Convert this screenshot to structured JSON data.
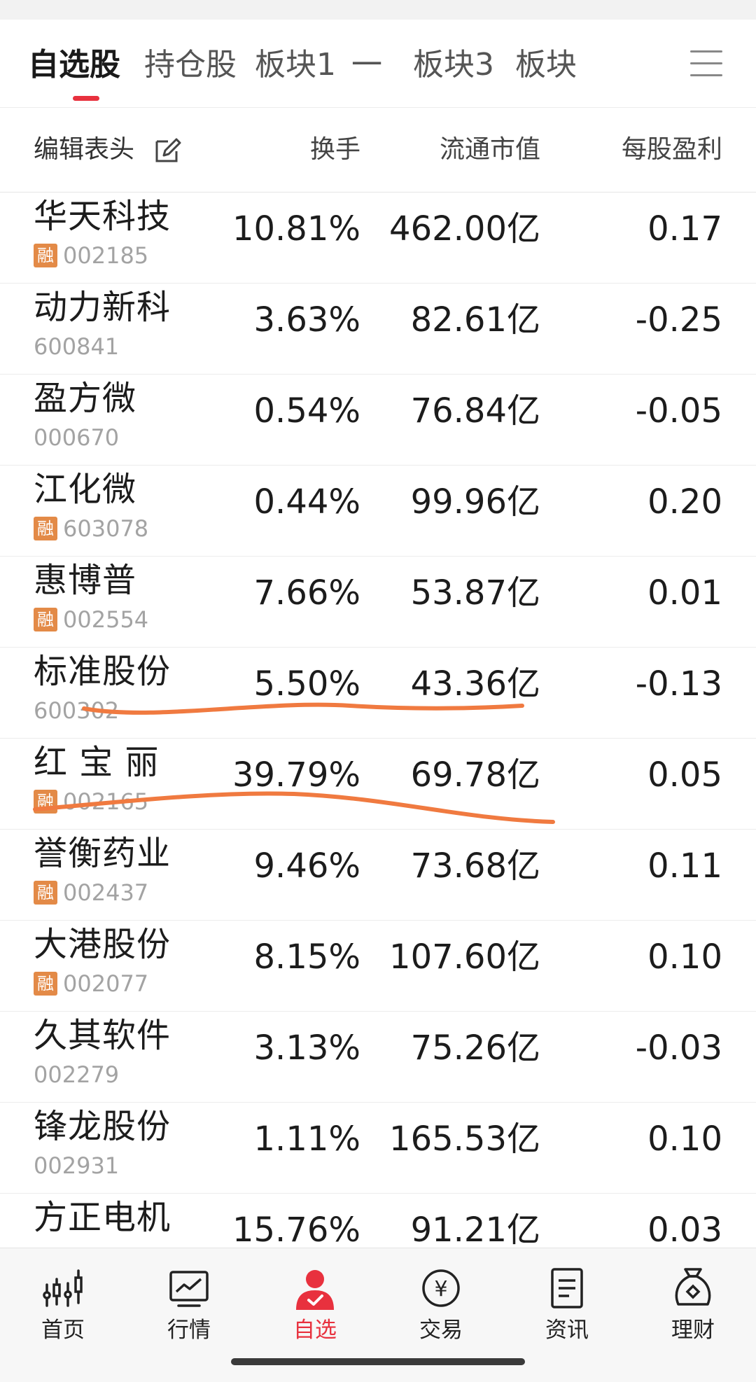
{
  "tabs": [
    {
      "label": "自选股",
      "active": true
    },
    {
      "label": "持仓股",
      "active": false
    },
    {
      "label": "板块1",
      "active": false
    },
    {
      "label": "一",
      "active": false
    },
    {
      "label": "板块3",
      "active": false
    },
    {
      "label": "板块",
      "active": false
    }
  ],
  "header": {
    "edit_label": "编辑表头",
    "col_turnover": "换手",
    "col_market_cap": "流通市值",
    "col_eps": "每股盈利"
  },
  "badge_text": "融",
  "stocks": [
    {
      "name": "华天科技",
      "code": "002185",
      "margin": true,
      "turnover": "10.81%",
      "market_cap": "462.00亿",
      "eps": "0.17"
    },
    {
      "name": "动力新科",
      "code": "600841",
      "margin": false,
      "turnover": "3.63%",
      "market_cap": "82.61亿",
      "eps": "-0.25"
    },
    {
      "name": "盈方微",
      "code": "000670",
      "margin": false,
      "turnover": "0.54%",
      "market_cap": "76.84亿",
      "eps": "-0.05"
    },
    {
      "name": "江化微",
      "code": "603078",
      "margin": true,
      "turnover": "0.44%",
      "market_cap": "99.96亿",
      "eps": "0.20"
    },
    {
      "name": "惠博普",
      "code": "002554",
      "margin": true,
      "turnover": "7.66%",
      "market_cap": "53.87亿",
      "eps": "0.01"
    },
    {
      "name": "标准股份",
      "code": "600302",
      "margin": false,
      "turnover": "5.50%",
      "market_cap": "43.36亿",
      "eps": "-0.13"
    },
    {
      "name": "红 宝 丽",
      "code": "002165",
      "margin": true,
      "turnover": "39.79%",
      "market_cap": "69.78亿",
      "eps": "0.05"
    },
    {
      "name": "誉衡药业",
      "code": "002437",
      "margin": true,
      "turnover": "9.46%",
      "market_cap": "73.68亿",
      "eps": "0.11"
    },
    {
      "name": "大港股份",
      "code": "002077",
      "margin": true,
      "turnover": "8.15%",
      "market_cap": "107.60亿",
      "eps": "0.10"
    },
    {
      "name": "久其软件",
      "code": "002279",
      "margin": false,
      "turnover": "3.13%",
      "market_cap": "75.26亿",
      "eps": "-0.03"
    },
    {
      "name": "锋龙股份",
      "code": "002931",
      "margin": false,
      "turnover": "1.11%",
      "market_cap": "165.53亿",
      "eps": "0.10"
    },
    {
      "name": "方正电机",
      "code": "",
      "margin": false,
      "turnover": "15.76%",
      "market_cap": "91.21亿",
      "eps": "0.03"
    }
  ],
  "nav": [
    {
      "label": "首页",
      "icon": "candlestick-icon",
      "active": false
    },
    {
      "label": "行情",
      "icon": "chart-icon",
      "active": false
    },
    {
      "label": "自选",
      "icon": "user-check-icon",
      "active": true
    },
    {
      "label": "交易",
      "icon": "yen-icon",
      "active": false
    },
    {
      "label": "资讯",
      "icon": "document-icon",
      "active": false
    },
    {
      "label": "理财",
      "icon": "money-bag-icon",
      "active": false
    }
  ],
  "colors": {
    "accent": "#e8313e",
    "badge": "#e38a47",
    "annotation": "#f07a40"
  }
}
